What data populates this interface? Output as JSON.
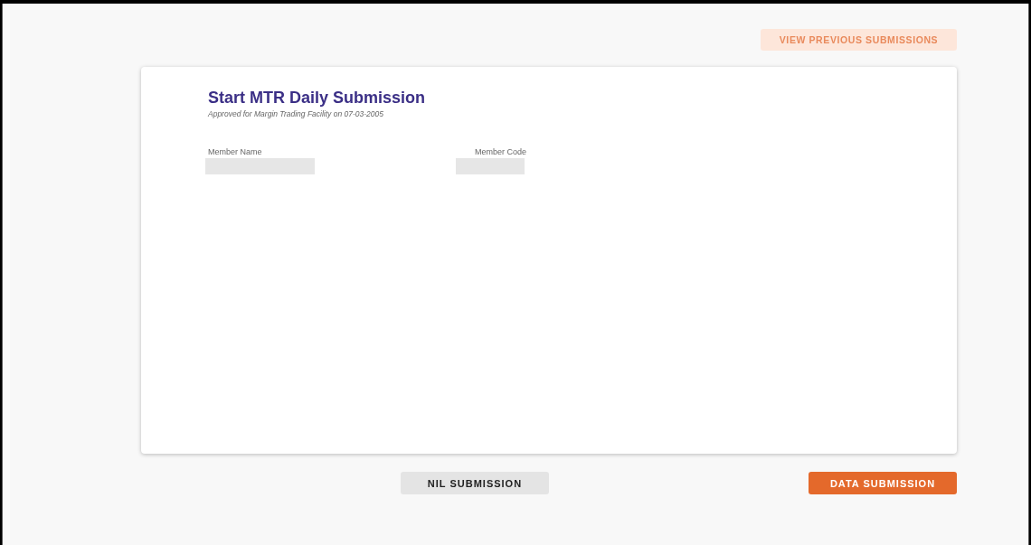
{
  "top_button": {
    "label": "VIEW PREVIOUS SUBMISSIONS",
    "disabled": true
  },
  "card": {
    "title": "Start MTR Daily Submission",
    "subtitle": "Approved for Margin Trading Facility on 07-03-2005",
    "fields": [
      {
        "label": "Member Name",
        "kind": "wide"
      },
      {
        "label": "Member Code",
        "kind": "narrow"
      }
    ]
  },
  "buttons": [
    {
      "label": "NIL SUBMISSION",
      "kind": "secondary"
    },
    {
      "label": "DATA SUBMISSION",
      "kind": "primary"
    }
  ]
}
